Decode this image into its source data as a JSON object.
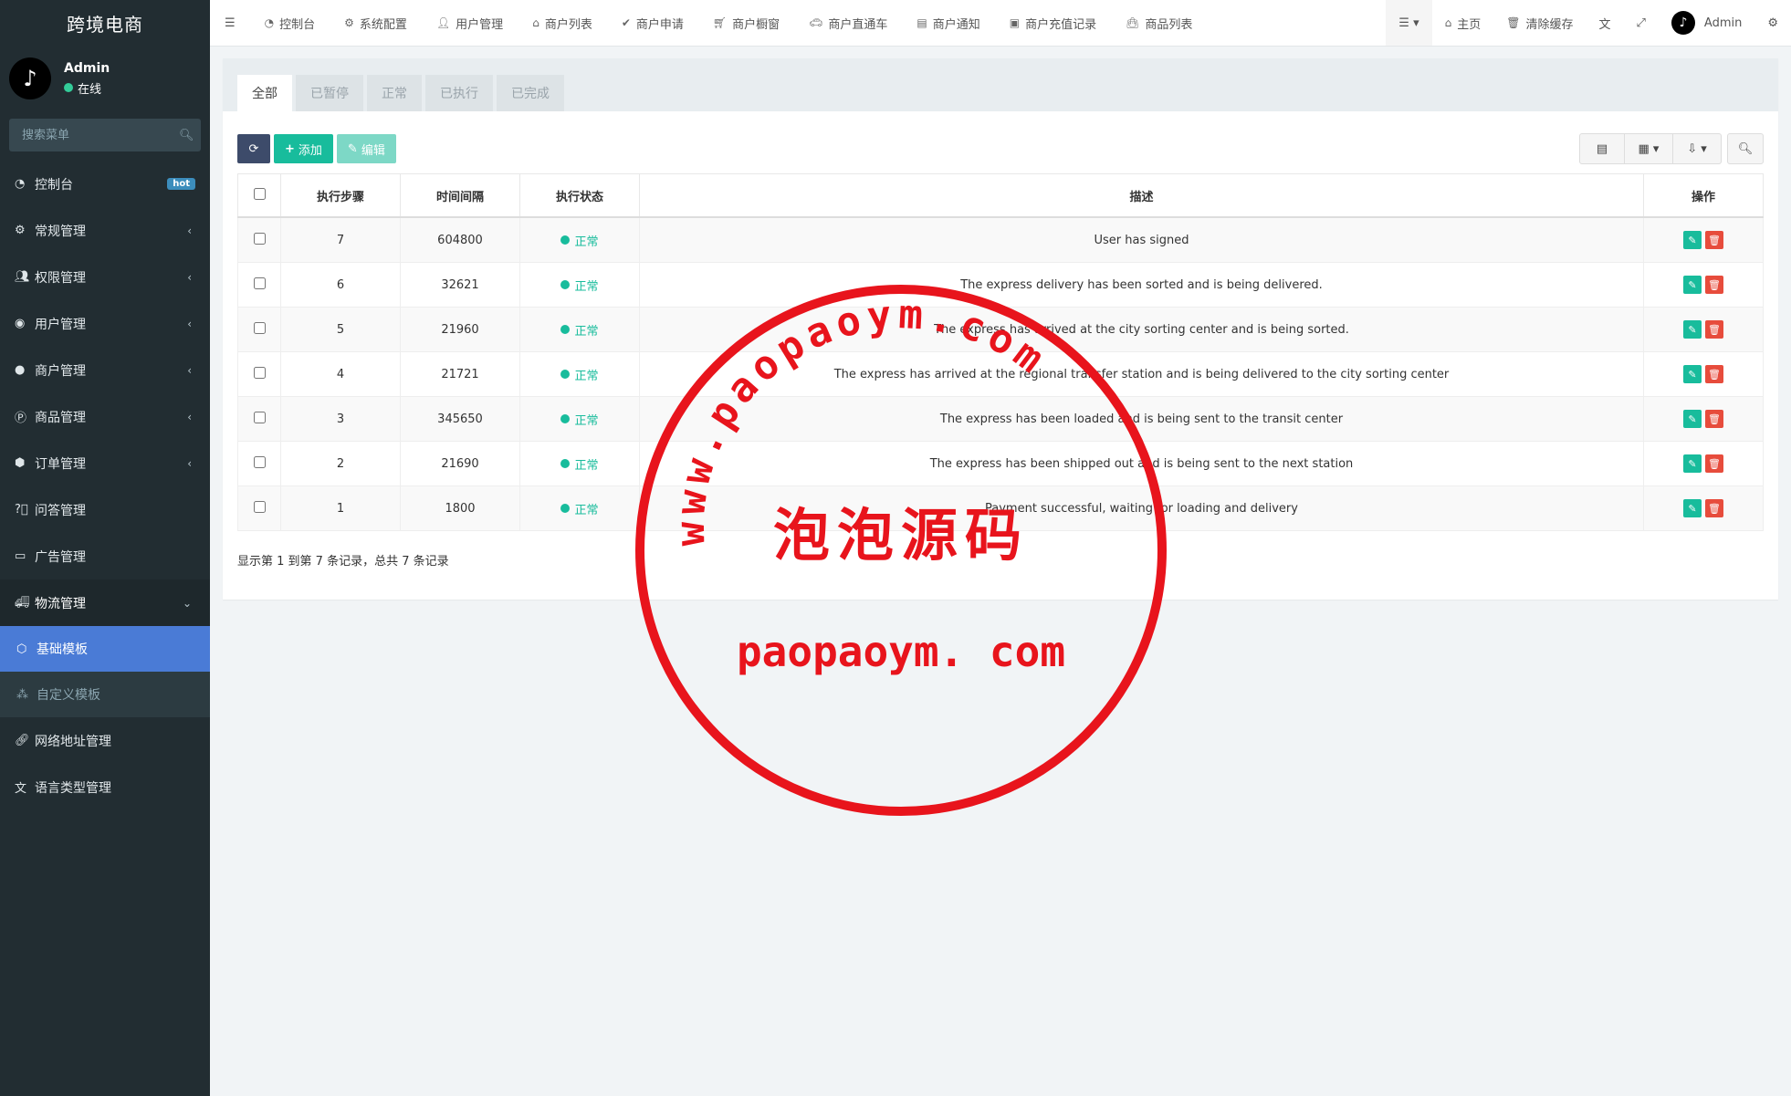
{
  "app_title": "跨境电商",
  "user": {
    "name": "Admin",
    "status": "在线"
  },
  "search": {
    "placeholder": "搜索菜单"
  },
  "sidebar": {
    "items": [
      {
        "label": "控制台",
        "badge": "hot"
      },
      {
        "label": "常规管理"
      },
      {
        "label": "权限管理"
      },
      {
        "label": "用户管理"
      },
      {
        "label": "商户管理"
      },
      {
        "label": "商品管理"
      },
      {
        "label": "订单管理"
      },
      {
        "label": "问答管理"
      },
      {
        "label": "广告管理"
      },
      {
        "label": "物流管理"
      },
      {
        "label": "网络地址管理"
      },
      {
        "label": "语言类型管理"
      }
    ],
    "submenu": [
      {
        "label": "基础模板"
      },
      {
        "label": "自定义模板"
      }
    ]
  },
  "topnav": {
    "items": [
      "控制台",
      "系统配置",
      "用户管理",
      "商户列表",
      "商户申请",
      "商户橱窗",
      "商户直通车",
      "商户通知",
      "商户充值记录",
      "商品列表"
    ],
    "home": "主页",
    "clear_cache": "清除缓存",
    "admin": "Admin"
  },
  "tabs": [
    "全部",
    "已暂停",
    "正常",
    "已执行",
    "已完成"
  ],
  "toolbar": {
    "add": "添加",
    "edit": "编辑"
  },
  "table": {
    "headers": [
      "执行步骤",
      "时间间隔",
      "执行状态",
      "描述",
      "操作"
    ],
    "rows": [
      {
        "step": "7",
        "interval": "604800",
        "status": "正常",
        "desc": "User has signed"
      },
      {
        "step": "6",
        "interval": "32621",
        "status": "正常",
        "desc": "The express delivery has been sorted and is being delivered."
      },
      {
        "step": "5",
        "interval": "21960",
        "status": "正常",
        "desc": "The express has arrived at the city sorting center and is being sorted."
      },
      {
        "step": "4",
        "interval": "21721",
        "status": "正常",
        "desc": "The express has arrived at the regional transfer station and is being delivered to the city sorting center"
      },
      {
        "step": "3",
        "interval": "345650",
        "status": "正常",
        "desc": "The express has been loaded and is being sent to the transit center"
      },
      {
        "step": "2",
        "interval": "21690",
        "status": "正常",
        "desc": "The express has been shipped out and is being sent to the next station"
      },
      {
        "step": "1",
        "interval": "1800",
        "status": "正常",
        "desc": "Payment successful, waiting for loading and delivery"
      }
    ]
  },
  "summary": "显示第 1 到第 7 条记录，总共 7 条记录",
  "watermark": {
    "arc_text": "www.paopaoym.com",
    "chinese": "泡泡源码",
    "bottom": "paopaoym. com",
    "color": "#e8141c"
  }
}
